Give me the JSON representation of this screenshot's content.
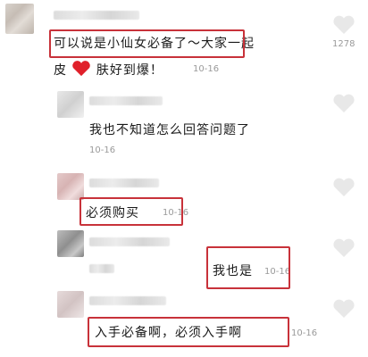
{
  "comments": [
    {
      "text_line1": "可以说是小仙女必备了～大家一起",
      "text_line2_a": "皮",
      "text_line2_b": "肤好到爆！",
      "time": "10-16",
      "likes": "1278",
      "heart_emoji_color": "#e0202a"
    },
    {
      "text": "我也不知道怎么回答问题了",
      "time": "10-16"
    },
    {
      "text": "必须购买",
      "time": "10-16"
    },
    {
      "text": "我也是",
      "time": "10-16"
    },
    {
      "text": "入手必备啊，必须入手啊",
      "time": "10-16"
    }
  ],
  "colors": {
    "highlight_box": "#c8323a",
    "like_heart": "#e8e8e8",
    "timestamp": "#9a9a9a"
  },
  "icons": [
    "heart-icon"
  ]
}
